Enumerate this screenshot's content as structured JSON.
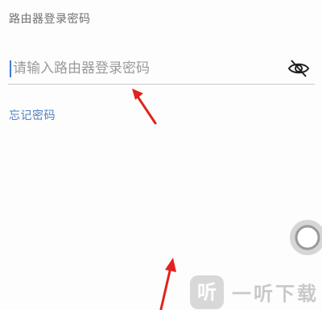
{
  "login": {
    "section_title": "路由器登录密码",
    "password_placeholder": "请输入路由器登录密码",
    "password_value": "",
    "forgot_link": "忘记密码"
  },
  "icons": {
    "visibility_toggle": "eye-off-icon",
    "floating_button": "circle-icon",
    "annotation": "red-arrow-icon"
  },
  "watermark": {
    "logo_char": "听",
    "text": "一听下载"
  },
  "colors": {
    "accent": "#3a7bd5",
    "link": "#4f7fc0",
    "annotation_arrow": "#e0231e"
  }
}
